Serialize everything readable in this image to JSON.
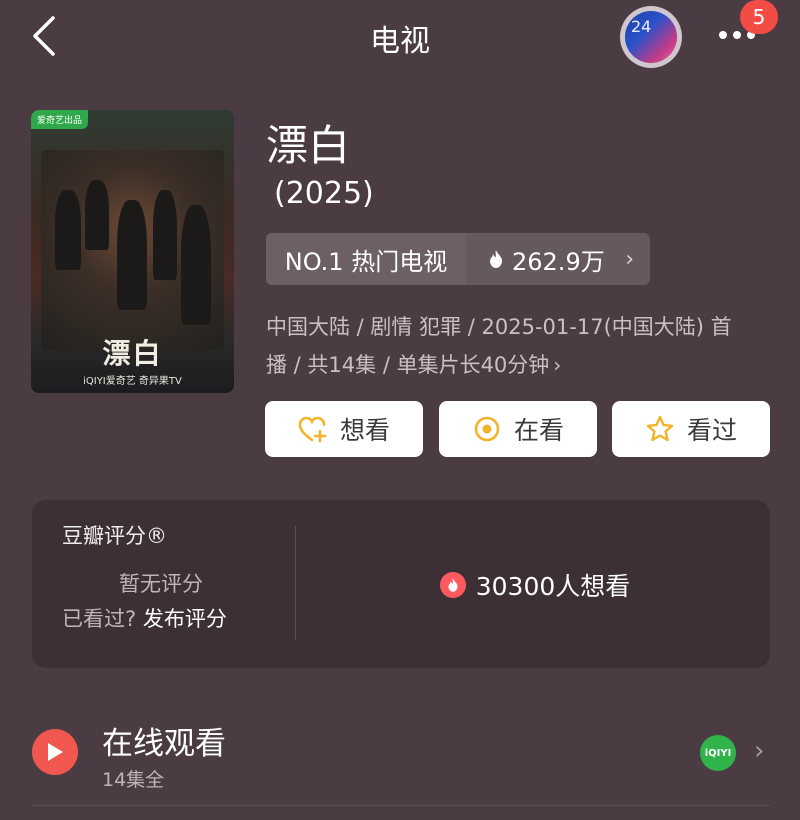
{
  "header": {
    "title": "电视",
    "back_icon": "chevron-left-icon",
    "avatar_number": "24",
    "more_icon": "more-dots-icon",
    "badge_count": "5"
  },
  "show": {
    "title": "漂白",
    "year": "(2025)",
    "rank_label": "NO.1 热门电视",
    "heat": "262.9万",
    "meta_line1": "中国大陆 / 剧情 犯罪 / 2025-01-17(中国大陆) 首",
    "meta_line2": "播 / 共14集 / 单集片长40分钟",
    "poster": {
      "tag": "爱奇艺出品",
      "logo_text": "漂白",
      "footer": "iQIYI爱奇艺  奇异果TV"
    }
  },
  "actions": [
    {
      "label": "想看",
      "icon": "heart-plus-icon"
    },
    {
      "label": "在看",
      "icon": "target-icon"
    },
    {
      "label": "看过",
      "icon": "star-outline-icon"
    }
  ],
  "rating": {
    "label": "豆瓣评分®",
    "none": "暂无评分",
    "seen_question": "已看过?",
    "publish": "发布评分",
    "wish_count": "30300人想看"
  },
  "online": {
    "title": "在线观看",
    "subtitle": "14集全",
    "provider_icon": "iqiyi-icon",
    "provider_text": "iQIYI"
  },
  "colors": {
    "background": "#4a3c42",
    "accent_yellow": "#f3b329",
    "accent_red": "#f0574f",
    "iqiyi_green": "#2fb34a"
  }
}
